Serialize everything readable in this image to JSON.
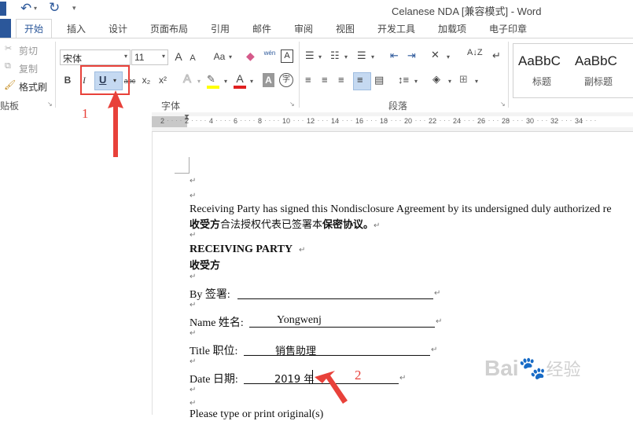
{
  "title_bar": {
    "title": "Celanese NDA [兼容模式] - Word",
    "undo_icon": "undo-icon",
    "redo_icon": "redo-icon"
  },
  "tabs": [
    "开始",
    "插入",
    "设计",
    "页面布局",
    "引用",
    "邮件",
    "审阅",
    "视图",
    "开发工具",
    "加载项",
    "电子印章"
  ],
  "clipboard": {
    "cut": "剪切",
    "copy": "复制",
    "format_painter": "格式刷",
    "group_label": "贴板"
  },
  "font": {
    "family_value": "宋体",
    "size_value": "11",
    "grow": "A",
    "shrink": "A",
    "change_case": "Aa",
    "phonetic": "wén",
    "bold": "B",
    "italic": "I",
    "underline": "U",
    "strikethrough": "abc",
    "subscript": "x₂",
    "superscript": "x²",
    "text_effects": "A",
    "font_color": "A",
    "shading": "A",
    "enclose": "字",
    "group_label": "字体"
  },
  "paragraph": {
    "group_label": "段落"
  },
  "styles": {
    "items": [
      {
        "preview": "AaBbC",
        "name": "标题"
      },
      {
        "preview": "AaBbC",
        "name": "副标题"
      }
    ]
  },
  "ruler": {
    "ticks": [
      "2",
      "2",
      "4",
      "6",
      "8",
      "10",
      "12",
      "14",
      "16",
      "18",
      "20",
      "22",
      "24",
      "26",
      "28",
      "30",
      "32",
      "34"
    ]
  },
  "annotations": {
    "label_1": "1",
    "label_2": "2"
  },
  "document": {
    "para_mark": "↵",
    "line1": "Receiving Party has signed this Nondisclosure Agreement by its undersigned duly authorized re",
    "line2_bold_a": "收受方",
    "line2_normal": "合法授权代表已签署本",
    "line2_bold_b": "保密协议。",
    "heading_en": "RECEIVING PARTY",
    "heading_cn": "收受方",
    "by_label": "By 签署:",
    "name_label": "Name 姓名:",
    "name_value": "Yongwenj",
    "title_label": "Title 职位:",
    "title_value": "销售助理",
    "date_label": "Date 日期:",
    "date_value": "2019 年",
    "last_line": "Please type or print original(s)"
  },
  "colors": {
    "accent": "#2b579a",
    "annotation_red": "#e8413a",
    "highlight_box": "#e8413a"
  }
}
